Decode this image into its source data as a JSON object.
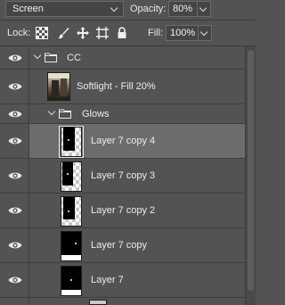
{
  "options": {
    "blend_mode": "Screen",
    "opacity_label": "Opacity:",
    "opacity_value": "80%",
    "lock_label": "Lock:",
    "fill_label": "Fill:",
    "fill_value": "100%"
  },
  "layers": [
    {
      "name": "CC",
      "kind": "group",
      "expanded": true,
      "visible": true,
      "selected": false
    },
    {
      "name": "Softlight - Fill 20%",
      "kind": "photo",
      "visible": true,
      "selected": false
    },
    {
      "name": "Glows",
      "kind": "group",
      "expanded": true,
      "visible": true,
      "selected": false
    },
    {
      "name": "Layer 7 copy 4",
      "kind": "layer",
      "visible": true,
      "selected": true
    },
    {
      "name": "Layer 7 copy 3",
      "kind": "layer",
      "visible": true,
      "selected": false
    },
    {
      "name": "Layer 7 copy 2",
      "kind": "layer",
      "visible": true,
      "selected": false
    },
    {
      "name": "Layer 7 copy",
      "kind": "layer",
      "visible": true,
      "selected": false
    },
    {
      "name": "Layer 7",
      "kind": "layer",
      "visible": true,
      "selected": false
    }
  ],
  "icons": {
    "eye": "eye-icon",
    "folder": "folder-icon",
    "lock_transparent": "checkerboard-icon",
    "lock_image": "brush-icon",
    "lock_position": "move-icon",
    "lock_artboard": "artboard-icon",
    "lock_all": "lock-icon"
  },
  "colors": {
    "panel_bg": "#535353",
    "selected_bg": "#6c6c6c",
    "field_bg": "#454545"
  }
}
